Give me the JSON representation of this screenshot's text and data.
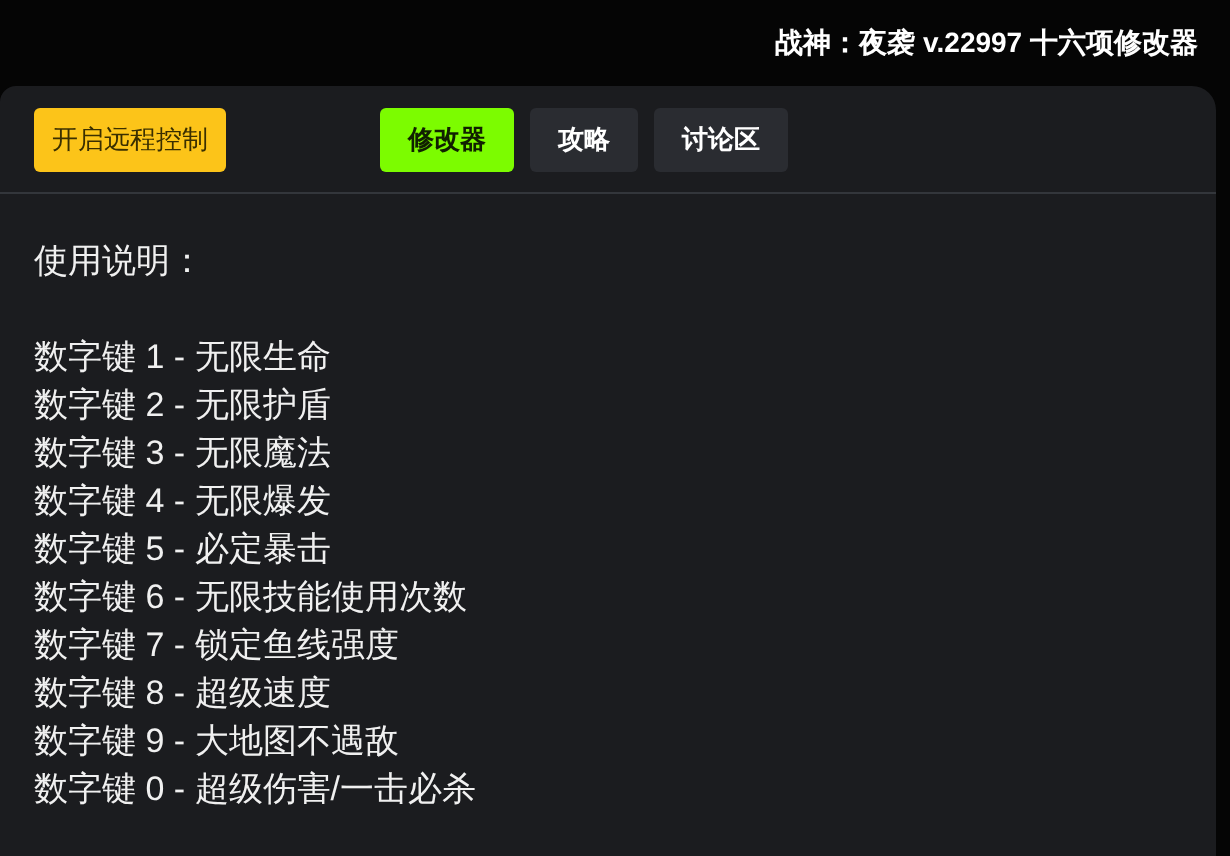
{
  "window": {
    "title": "战神：夜袭 v.22997 十六项修改器"
  },
  "remote_button": "开启远程控制",
  "tabs": [
    {
      "label": "修改器",
      "selected": true
    },
    {
      "label": "攻略",
      "selected": false
    },
    {
      "label": "讨论区",
      "selected": false
    }
  ],
  "instructions": {
    "heading": "使用说明：",
    "lines": [
      "数字键 1 - 无限生命",
      "数字键 2 - 无限护盾",
      "数字键 3 - 无限魔法",
      "数字键 4 - 无限爆发",
      "数字键 5 - 必定暴击",
      "数字键 6 - 无限技能使用次数",
      "数字键 7 - 锁定鱼线强度",
      "数字键 8 - 超级速度",
      "数字键 9 - 大地图不遇敌",
      "数字键 0 - 超级伤害/一击必杀"
    ]
  }
}
